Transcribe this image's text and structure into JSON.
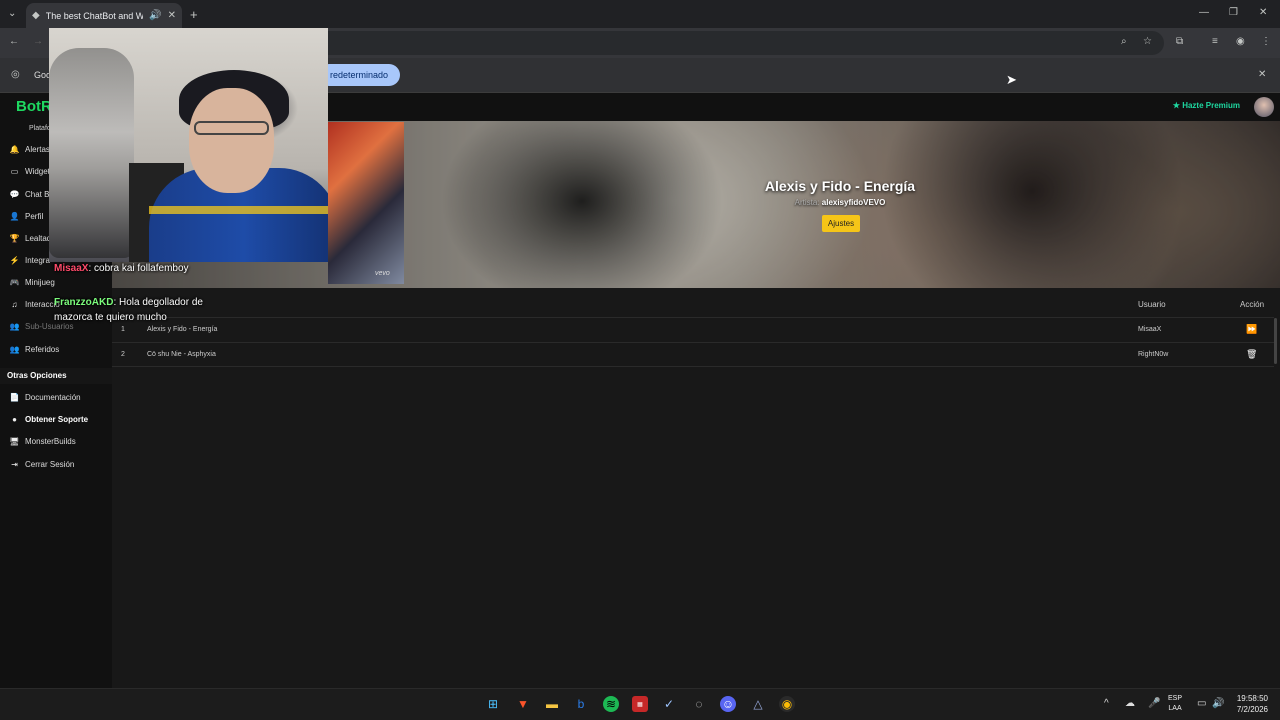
{
  "browser": {
    "tab_title": "The best ChatBot and Widg",
    "infobar_button": "redeterminado",
    "infobar_left_text": "Goo"
  },
  "app": {
    "logo": "BotR",
    "platform_label": "Platafo",
    "premium_label": "Hazte Premium"
  },
  "sidebar": {
    "items": [
      {
        "label": "Alertas",
        "icon": "bell-icon"
      },
      {
        "label": "Widget",
        "icon": "widget-icon"
      },
      {
        "label": "Chat Bo",
        "icon": "chat-icon"
      },
      {
        "label": "Perfil",
        "icon": "user-icon"
      },
      {
        "label": "Lealtad",
        "icon": "trophy-icon"
      },
      {
        "label": "Integra",
        "icon": "plug-icon"
      },
      {
        "label": "Minijueg",
        "icon": "gamepad-icon"
      },
      {
        "label": "Interacció",
        "icon": "music-icon"
      },
      {
        "label": "Sub-Usuarios",
        "icon": "users-icon"
      },
      {
        "label": "Referidos",
        "icon": "users-icon"
      }
    ],
    "section_title": "Otras Opciones",
    "other_items": [
      {
        "label": "Documentación",
        "icon": "book-icon"
      },
      {
        "label": "Obtener Soporte",
        "icon": "help-icon"
      },
      {
        "label": "MonsterBuilds",
        "icon": "monitor-icon"
      },
      {
        "label": "Cerrar Sesión",
        "icon": "logout-icon"
      }
    ]
  },
  "player": {
    "thumb_label": "vevo",
    "song_title": "Alexis y Fido - Energía",
    "artist_label": "Artista:",
    "artist_name": "alexisyfidoVEVO",
    "settings_button": "Ajustes"
  },
  "queue": {
    "headers": {
      "user": "Usuario",
      "action": "Acción"
    },
    "rows": [
      {
        "num": "1",
        "song": "Alexis y Fido - Energía",
        "user": "MisaaX",
        "action_icon": "skip-icon"
      },
      {
        "num": "2",
        "song": "Cö shu Nie - Asphyxia",
        "user": "RightN0w",
        "action_icon": "trash-icon"
      }
    ]
  },
  "chat_overlay": [
    {
      "user": "MisaaX",
      "message": "cobra kai follafemboy"
    },
    {
      "user": "FranzzoAKD",
      "message": "Hola degollador de mazorca te quiero mucho"
    }
  ],
  "taskbar": {
    "lang_line1": "ESP",
    "lang_line2": "LAA",
    "time": "19:58:50",
    "date": "7/2/2026"
  },
  "colors": {
    "accent_green": "#1ed760",
    "settings_yellow": "#f5c518",
    "infobar_button": "#a8c7fa"
  }
}
